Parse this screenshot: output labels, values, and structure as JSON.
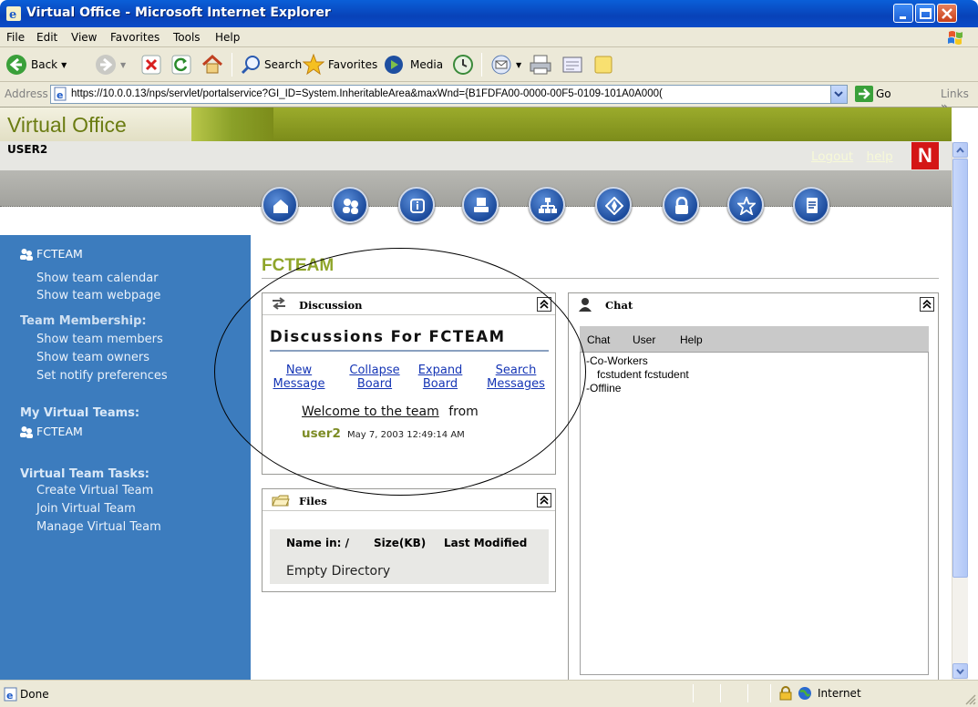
{
  "window": {
    "title": "Virtual Office - Microsoft Internet Explorer"
  },
  "menubar": {
    "items": [
      "File",
      "Edit",
      "View",
      "Favorites",
      "Tools",
      "Help"
    ]
  },
  "toolbar": {
    "back_label": "Back",
    "search_label": "Search",
    "favorites_label": "Favorites",
    "media_label": "Media"
  },
  "address": {
    "label": "Address",
    "url": "https://10.0.0.13/nps/servlet/portalservice?GI_ID=System.InheritableArea&maxWnd={B1FDFA00-0000-00F5-0109-101A0A000(",
    "go_label": "Go",
    "links_label": "Links"
  },
  "banner": {
    "title": "Virtual Office",
    "logout_label": "Logout",
    "help_label": "help",
    "n_logo": "N",
    "user": "USER2"
  },
  "nav_icons": [
    "home-icon",
    "team-icon",
    "info-icon",
    "printer-icon",
    "org-chart-icon",
    "compass-icon",
    "lock-icon",
    "star-icon",
    "document-icon"
  ],
  "sidebar": {
    "team_name": "FCTEAM",
    "team_links": [
      "Show team calendar",
      "Show team webpage"
    ],
    "membership_heading": "Team Membership:",
    "membership_links": [
      "Show team members",
      "Show team owners",
      "Set notify preferences"
    ],
    "my_teams_heading": "My Virtual Teams:",
    "my_team": "FCTEAM",
    "tasks_heading": "Virtual Team Tasks:",
    "task_links": [
      "Create Virtual Team",
      "Join Virtual Team",
      "Manage Virtual Team"
    ]
  },
  "main": {
    "title": "FCTEAM"
  },
  "discussion": {
    "header": "Discussion",
    "title": "Discussions For FCTEAM",
    "links": [
      {
        "line1": "New",
        "line2": "Message"
      },
      {
        "line1": "Collapse",
        "line2": "Board"
      },
      {
        "line1": "Expand",
        "line2": "Board"
      },
      {
        "line1": "Search",
        "line2": "Messages"
      }
    ],
    "message_title": "Welcome to the team",
    "from_label": "from",
    "author": "user2",
    "date": "May 7, 2003 12:49:14 AM"
  },
  "files": {
    "header": "Files",
    "col_name": "Name in: /",
    "col_size": "Size(KB)",
    "col_modified": "Last Modified",
    "empty_text": "Empty Directory"
  },
  "chat": {
    "header": "Chat",
    "menu": [
      "Chat",
      "User",
      "Help"
    ],
    "tree": [
      "-Co-Workers",
      "fcstudent fcstudent",
      "-Offline"
    ]
  },
  "statusbar": {
    "status": "Done",
    "zone": "Internet"
  }
}
